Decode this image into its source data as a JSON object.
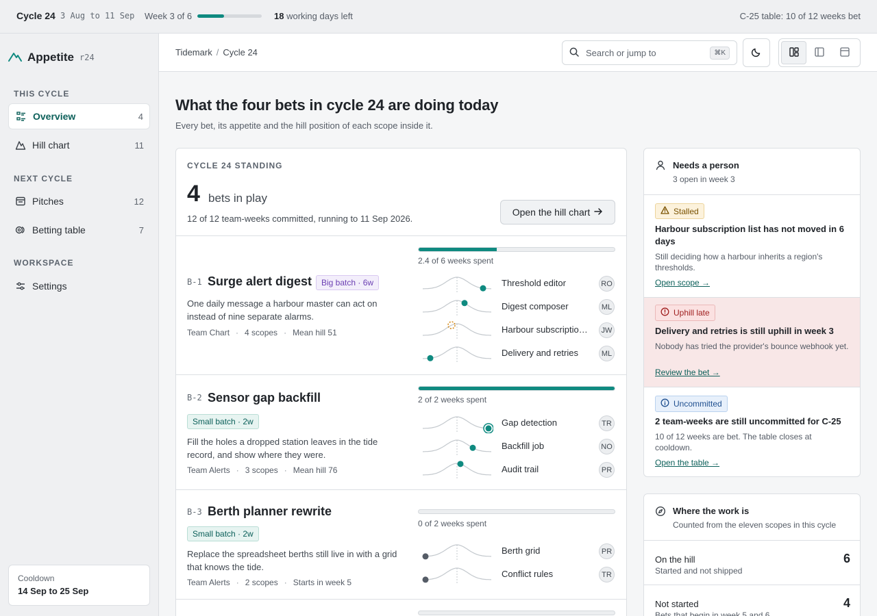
{
  "topbar": {
    "cycle": "Cycle 24",
    "dates": "3 Aug to 11 Sep",
    "week": "Week 3 of 6",
    "week_progress": 0.42,
    "days_num": "18",
    "days_text": "working days left",
    "table": "C-25 table: 10 of 12 weeks bet"
  },
  "sidebar": {
    "brand": "Appetite",
    "brand_version": "r24",
    "sections": [
      "THIS CYCLE",
      "NEXT CYCLE",
      "WORKSPACE"
    ],
    "items": [
      {
        "label": "Overview",
        "count": "4"
      },
      {
        "label": "Hill chart",
        "count": "11"
      },
      {
        "label": "Pitches",
        "count": "12"
      },
      {
        "label": "Betting table",
        "count": "7"
      },
      {
        "label": "Settings",
        "count": ""
      }
    ],
    "cooldown_label": "Cooldown",
    "cooldown_dates": "14 Sep to 25 Sep"
  },
  "header": {
    "crumbs": [
      "Tidemark",
      "Cycle 24"
    ],
    "crumb_sep": "/",
    "search_placeholder": "Search or jump to",
    "search_shortcut": "⌘K"
  },
  "page": {
    "title": "What the four bets in cycle 24 are doing today",
    "subtitle": "Every bet, its appetite and the hill position of each scope inside it."
  },
  "standing": {
    "label": "CYCLE 24 STANDING",
    "count": "4",
    "count_label": "bets in play",
    "desc": "12 of 12 team-weeks committed, running to 11 Sep 2026.",
    "button": "Open the hill chart",
    "meta_sep": "·"
  },
  "bets": [
    {
      "code": "B-1",
      "name": "Surge alert digest",
      "badge": "Big batch · 6w",
      "badge_kind": "big",
      "desc": "One daily message a harbour master can act on instead of nine separate alarms.",
      "team": "Team Chart",
      "scopes": "4 scopes",
      "extra": "Mean hill 51",
      "progress": 0.4,
      "progress_label": "2.4 of 6 weeks spent",
      "scope_list": [
        {
          "name": "Threshold editor",
          "owner": "RO",
          "hill": 0.88,
          "state": "normal"
        },
        {
          "name": "Digest composer",
          "owner": "ML",
          "hill": 0.61,
          "state": "normal"
        },
        {
          "name": "Harbour subscription list",
          "owner": "JW",
          "hill": 0.42,
          "state": "stalled"
        },
        {
          "name": "Delivery and retries",
          "owner": "ML",
          "hill": 0.11,
          "state": "normal"
        }
      ]
    },
    {
      "code": "B-2",
      "name": "Sensor gap backfill",
      "badge": "Small batch · 2w",
      "badge_kind": "small",
      "desc": "Fill the holes a dropped station leaves in the tide record, and show where they were.",
      "team": "Team Alerts",
      "scopes": "3 scopes",
      "extra": "Mean hill 76",
      "progress": 1.0,
      "progress_label": "2 of 2 weeks spent",
      "scope_list": [
        {
          "name": "Gap detection",
          "owner": "TR",
          "hill": 0.99,
          "state": "done"
        },
        {
          "name": "Backfill job",
          "owner": "NO",
          "hill": 0.73,
          "state": "normal"
        },
        {
          "name": "Audit trail",
          "owner": "PR",
          "hill": 0.55,
          "state": "normal"
        }
      ]
    },
    {
      "code": "B-3",
      "name": "Berth planner rewrite",
      "badge": "Small batch · 2w",
      "badge_kind": "small",
      "desc": "Replace the spreadsheet berths still live in with a grid that knows the tide.",
      "team": "Team Alerts",
      "scopes": "2 scopes",
      "extra": "Starts in week 5",
      "progress": 0,
      "progress_label": "0 of 2 weeks spent",
      "scope_list": [
        {
          "name": "Berth grid",
          "owner": "PR",
          "hill": 0.0,
          "state": "notstarted"
        },
        {
          "name": "Conflict rules",
          "owner": "TR",
          "hill": 0.0,
          "state": "notstarted"
        }
      ]
    }
  ],
  "needs": {
    "title": "Needs a person",
    "sub": "3 open in week 3",
    "alerts": [
      {
        "chip": "Stalled",
        "title": "Harbour subscription list has not moved in 6 days",
        "body": "Still deciding how a harbour inherits a region's thresholds.",
        "link": "Open scope →"
      },
      {
        "chip": "Uphill late",
        "title": "Delivery and retries is still uphill in week 3",
        "body": "Nobody has tried the provider's bounce webhook yet.",
        "link": "Review the bet →"
      },
      {
        "chip": "Uncommitted",
        "title": "2 team-weeks are still uncommitted for C-25",
        "body": "10 of 12 weeks are bet. The table closes at cooldown.",
        "link": "Open the table →"
      }
    ]
  },
  "work": {
    "title": "Where the work is",
    "sub": "Counted from the eleven scopes in this cycle",
    "rows": [
      {
        "label": "On the hill",
        "sub": "Started and not shipped",
        "num": "6"
      },
      {
        "label": "Not started",
        "sub": "Bets that begin in week 5 and 6",
        "num": "4"
      }
    ]
  },
  "colors": {
    "accent": "#0f8a80",
    "stalled": "#d58a1a",
    "inactive": "#555c66"
  }
}
